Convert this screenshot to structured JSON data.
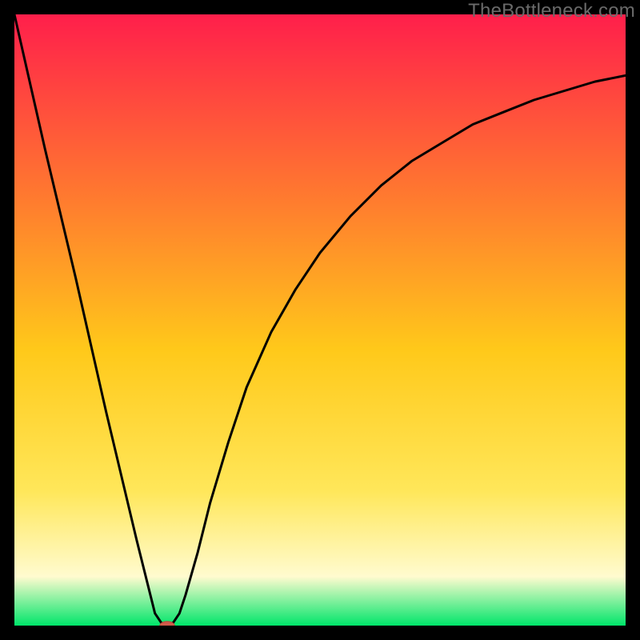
{
  "watermark": "TheBottleneck.com",
  "colors": {
    "gradient_top": "#ff1f4b",
    "gradient_mid_upper": "#ff7a2f",
    "gradient_mid": "#ffc91a",
    "gradient_mid_lower": "#ffe75a",
    "gradient_pale": "#fffbcf",
    "gradient_bottom": "#00e56a",
    "curve": "#000000",
    "marker_fill": "#d05a4a",
    "marker_stroke": "#b3483a",
    "frame_bg": "#000000"
  },
  "chart_data": {
    "type": "line",
    "title": "",
    "xlabel": "",
    "ylabel": "",
    "xlim": [
      0,
      100
    ],
    "ylim": [
      0,
      100
    ],
    "series": [
      {
        "name": "bottleneck-curve",
        "x": [
          0,
          5,
          10,
          15,
          20,
          23,
          24,
          25,
          26,
          27,
          28,
          30,
          32,
          35,
          38,
          42,
          46,
          50,
          55,
          60,
          65,
          70,
          75,
          80,
          85,
          90,
          95,
          100
        ],
        "values": [
          100,
          78,
          57,
          35,
          14,
          2,
          0.5,
          0,
          0.5,
          2,
          5,
          12,
          20,
          30,
          39,
          48,
          55,
          61,
          67,
          72,
          76,
          79,
          82,
          84,
          86,
          87.5,
          89,
          90
        ]
      }
    ],
    "marker": {
      "x": 25,
      "y": 0,
      "rx": 1.2,
      "ry": 0.7
    }
  }
}
